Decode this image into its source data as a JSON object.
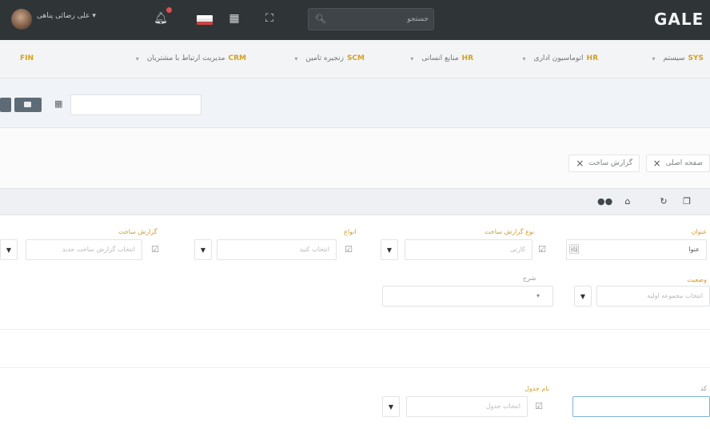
{
  "topbar": {
    "username": "علی رضائی پناهی",
    "user_caret": "▾",
    "search_placeholder": "جستجو",
    "logo": "GALE",
    "icons": [
      "avatar",
      "bell-icon",
      "flag-icon",
      "calculator-icon",
      "fullscreen-icon",
      "search-icon"
    ]
  },
  "modules": [
    {
      "code": "SYS",
      "label": "سیستم"
    },
    {
      "code": "HR",
      "label": "اتوماسیون اداری"
    },
    {
      "code": "HR",
      "label": "منابع انسانی"
    },
    {
      "code": "SCM",
      "label": "زنجیره تامین"
    },
    {
      "code": "CRM",
      "label": "مدیریت ارتباط با مشتریان"
    },
    {
      "code": "FIN",
      "label": ""
    }
  ],
  "tabs": [
    {
      "label": "صفحه اصلی"
    },
    {
      "label": "گزارش ساخت"
    }
  ],
  "form": {
    "fields": [
      {
        "label": "عنوان",
        "value": "عنوا"
      },
      {
        "label": "نوع گزارش ساخت",
        "value": "کارتی"
      },
      {
        "label": "انواع",
        "value": "انتخاب کنید"
      },
      {
        "label": "گزارش ساخت",
        "value": "انتخاب گزارش ساخت جدید"
      },
      {
        "label": "وضعیت",
        "value": "انتخاب مجموعه اولیه"
      },
      {
        "label": "شرح",
        "value": ""
      },
      {
        "label": "کد",
        "value": ""
      },
      {
        "label": "نام جدول",
        "value": "انتخاب جدول"
      }
    ]
  }
}
